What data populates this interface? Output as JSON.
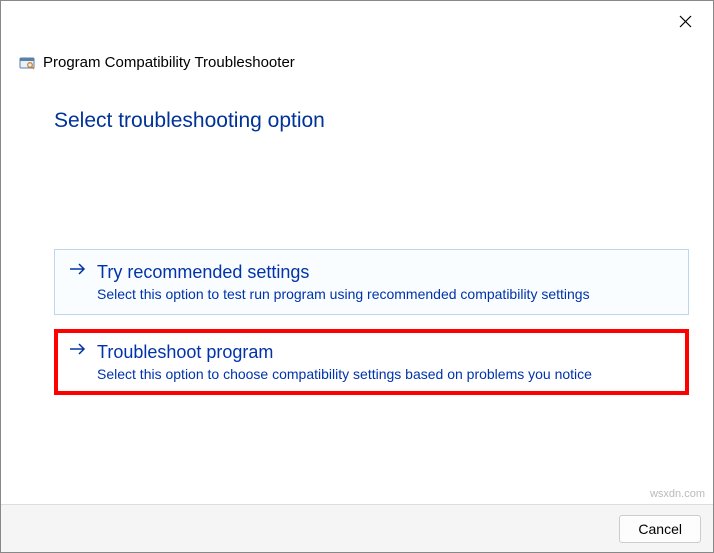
{
  "window": {
    "title": "Program Compatibility Troubleshooter"
  },
  "heading": "Select troubleshooting option",
  "options": [
    {
      "title": "Try recommended settings",
      "description": "Select this option to test run program using recommended compatibility settings"
    },
    {
      "title": "Troubleshoot program",
      "description": "Select this option to choose compatibility settings based on problems you notice"
    }
  ],
  "footer": {
    "cancel_label": "Cancel"
  },
  "watermark": "wsxdn.com"
}
